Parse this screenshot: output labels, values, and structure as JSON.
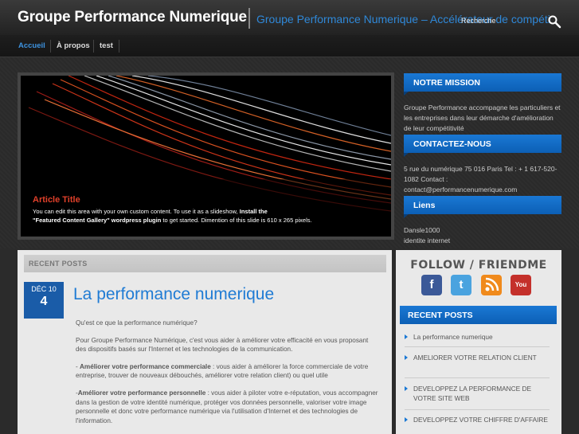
{
  "header": {
    "site_title": "Groupe Performance Numerique",
    "tagline": "Groupe Performance Numerique – Accélérateur de compétitivité",
    "search_placeholder": "Recherche"
  },
  "nav": {
    "items": [
      {
        "label": "Accueil",
        "active": true
      },
      {
        "label": "À propos"
      },
      {
        "label": "test"
      }
    ]
  },
  "slideshow": {
    "title": "Article Title",
    "text_part1": "You can edit this area with your own custom content. To use it as a slideshow, ",
    "text_bold1": "Install the",
    "text_bold2": "\"Featured Content Gallery\" wordpress plugin",
    "text_part2": " to get started. Dimention of this slide is 610 x 265 pixels."
  },
  "sidebar": {
    "mission_title": "NOTRE MISSION",
    "mission_text": "Groupe Performance accompagne les particuliers et les entreprises dans leur démarche d'amélioration de leur compétitivité",
    "contact_title": "CONTACTEZ-NOUS",
    "contact_text": "5 rue du numérique 75 016 Paris Tel : + 1 617-520-1082 Contact : contact@performancenumerique.com",
    "links_title": "Liens",
    "links": [
      "Dansle1000",
      "identite internet"
    ],
    "follow_title": "FOLLOW / FRIENDME",
    "recent_posts_title": "RECENT POSTS",
    "recent_posts": [
      "La performance numerique",
      "AMELIORER VOTRE RELATION CLIENT",
      "DEVELOPPEZ LA PERFORMANCE DE VOTRE SITE WEB",
      "DEVELOPPEZ VOTRE CHIFFRE D'AFFAIRE"
    ]
  },
  "main": {
    "section_label": "RECENT POSTS",
    "post": {
      "month": "DÉC 10",
      "day": "4",
      "title": "La performance numerique",
      "intro": "Qu'est ce que la performance numérique?",
      "p1": "Pour Groupe Performance Numérique, c'est vous aider à améliorer votre efficacité en vous proposant des dispositifs basés sur l'Internet et les technologies de la  communication.",
      "p2_prefix": "- ",
      "p2_bold": "Améliorer votre performance commerciale",
      "p2_rest": " : vous aider à améliorer la force commerciale de votre entreprise, trouver de nouveaux débouchés, améliorer votre  relation client) ou quel utile",
      "p3_prefix": "-",
      "p3_bold": "Améliorer votre performance personnelle",
      "p3_rest": " : vous aider à piloter votre e-réputation, vous accompagner dans la gestion de votre identité numérique, protéger vos données personnelle, valoriser votre image personnelle et donc votre performance numérique via l'utilisation d'Internet et des technologies de l'information."
    }
  },
  "colors": {
    "accent_blue": "#1a78d4",
    "title_blue": "#1f7bd4",
    "slide_title_red": "#e0402a"
  }
}
